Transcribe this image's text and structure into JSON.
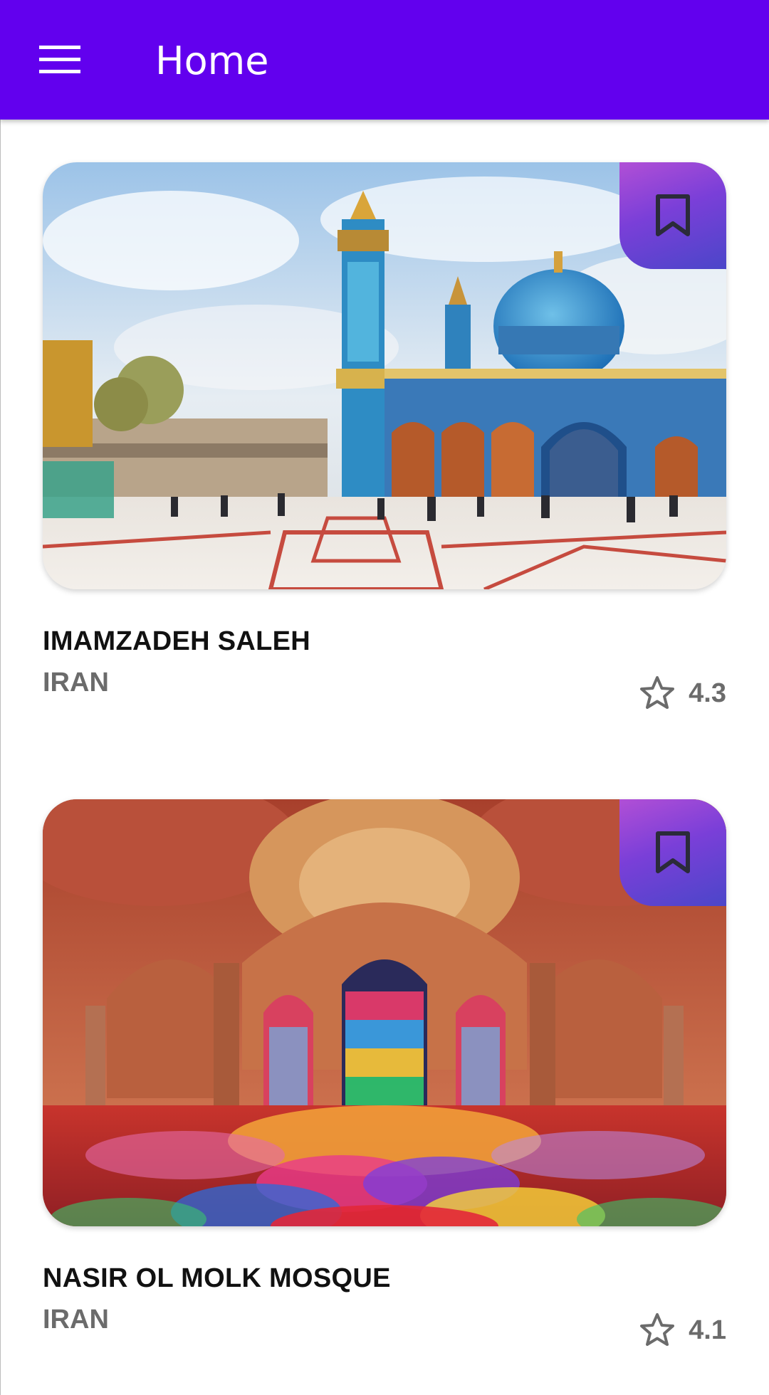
{
  "app_bar": {
    "title": "Home",
    "background": "#6200ee",
    "menu_icon": "hamburger-menu-icon"
  },
  "places": [
    {
      "name": "IMAMZADEH SALEH",
      "country": "IRAN",
      "rating": "4.3",
      "image": "mosque-courtyard-photo",
      "bookmark_icon": "bookmark-icon",
      "rating_icon": "star-outline-icon"
    },
    {
      "name": "NASIR OL MOLK MOSQUE",
      "country": "IRAN",
      "rating": "4.1",
      "image": "stained-glass-hall-photo",
      "bookmark_icon": "bookmark-icon",
      "rating_icon": "star-outline-icon"
    }
  ],
  "colors": {
    "bookmark_gradient": [
      "#b14fd6",
      "#4b46c9"
    ],
    "title_text": "#111111",
    "secondary_text": "#6b6b6b"
  }
}
